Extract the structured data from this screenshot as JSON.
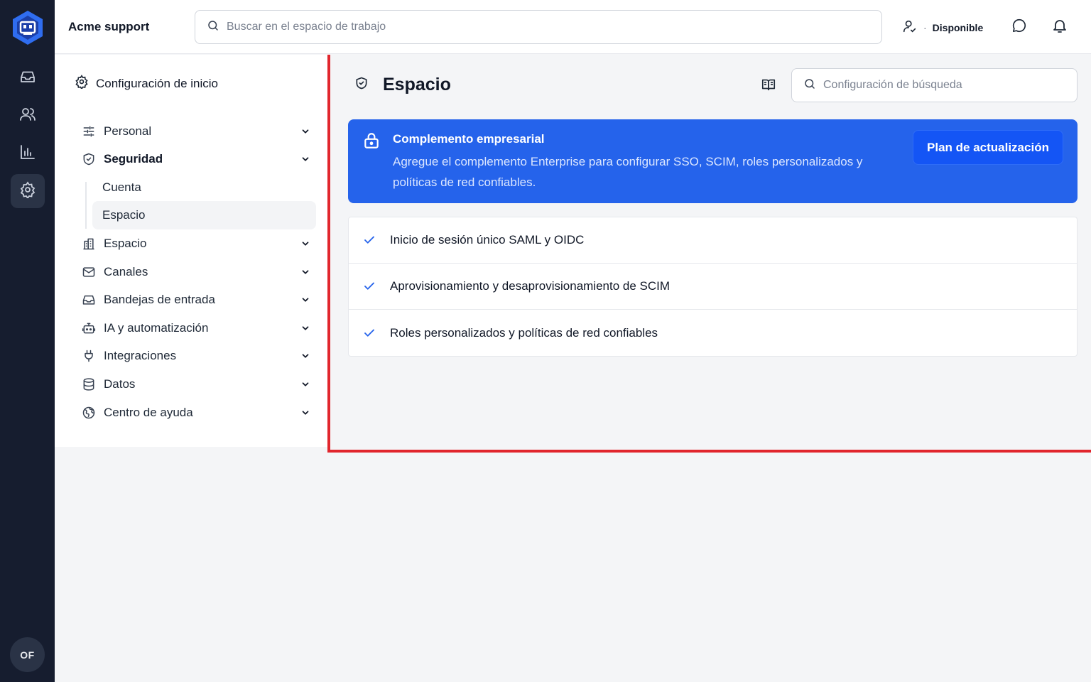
{
  "topbar": {
    "workspace_name": "Acme support",
    "search_placeholder": "Buscar en el espacio de trabajo",
    "status_separator": "·",
    "status_label": "Disponible"
  },
  "rail": {
    "avatar_initials": "OF",
    "icons": [
      "app-logo-icon",
      "inbox-icon",
      "users-icon",
      "reports-icon",
      "settings-icon"
    ]
  },
  "settings_nav": {
    "header": "Configuración de inicio",
    "items": [
      {
        "label": "Personal",
        "icon": "sliders-icon"
      },
      {
        "label": "Seguridad",
        "icon": "shield-icon"
      },
      {
        "label": "Espacio",
        "icon": "building-icon"
      },
      {
        "label": "Canales",
        "icon": "mail-icon"
      },
      {
        "label": "Bandejas de entrada",
        "icon": "inbox-icon"
      },
      {
        "label": "IA y automatización",
        "icon": "robot-icon"
      },
      {
        "label": "Integraciones",
        "icon": "plug-icon"
      },
      {
        "label": "Datos",
        "icon": "database-icon"
      },
      {
        "label": "Centro de ayuda",
        "icon": "globe-icon"
      }
    ],
    "security_sub_items": [
      {
        "label": "Cuenta"
      },
      {
        "label": "Espacio",
        "active": true
      }
    ]
  },
  "main": {
    "title": "Espacio",
    "search_placeholder": "Configuración de búsqueda",
    "banner": {
      "title": "Complemento empresarial",
      "text": "Agregue el complemento Enterprise para configurar SSO, SCIM, roles personalizados y políticas de red confiables.",
      "button_label": "Plan de actualización",
      "color": "#2563eb"
    },
    "features": [
      "Inicio de sesión único SAML y OIDC",
      "Aprovisionamiento y desaprovisionamiento de SCIM",
      "Roles personalizados y políticas de red confiables"
    ]
  },
  "colors": {
    "rail": "#161d2f",
    "accent": "#2563eb",
    "highlight_border": "#e1262d"
  }
}
